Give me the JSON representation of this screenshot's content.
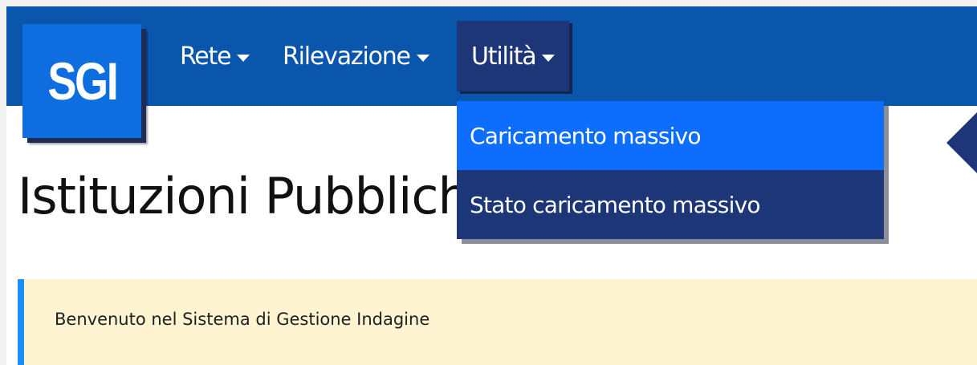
{
  "logo": {
    "text": "SGI"
  },
  "navbar": {
    "items": [
      {
        "label": "Rete"
      },
      {
        "label": "Rilevazione"
      },
      {
        "label": "Utilità"
      }
    ]
  },
  "dropdown": {
    "items": [
      {
        "label": "Caricamento massivo",
        "state": "hover"
      },
      {
        "label": "Stato caricamento massivo"
      }
    ]
  },
  "page": {
    "title": "Istituzioni Pubbliche"
  },
  "notice": {
    "text": "Benvenuto nel Sistema di Gestione Indagine"
  },
  "colors": {
    "navbar": "#0a56ad",
    "logo": "#0e6ee0",
    "menu_dark": "#1c3677",
    "menu_active": "#0d6efd",
    "notice_bg": "#fef4d2",
    "notice_border": "#1a8dff"
  },
  "icons": [
    "caret-down-icon",
    "arrow-left-icon"
  ]
}
